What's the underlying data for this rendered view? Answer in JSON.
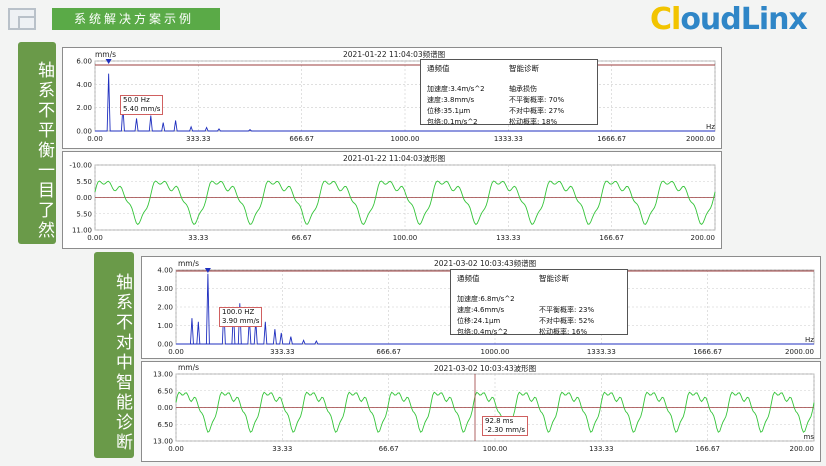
{
  "banner": {
    "title": "系统解决方案示例"
  },
  "logo": {
    "text_a": "Cl",
    "text_b": "oudLinx",
    "full": "CloudLinx"
  },
  "labels": {
    "left1": "轴系不平衡一目了然",
    "left2": "轴系不对中智能诊断"
  },
  "colors": {
    "banner": "#5aaa47",
    "side": "#6a9a49",
    "spectrum": "#1f2fbf",
    "wave": "#35c43a",
    "limit": "#9b3c3c"
  },
  "panels": [
    {
      "id": "p1",
      "title": "2021-01-22  11:04:03频谱图",
      "unit": "mm/s",
      "yticks": [
        "6.00",
        "4.00",
        "2.00",
        "0.00"
      ],
      "xticks": [
        "0.00",
        "333.33",
        "666.67",
        "1000.00",
        "1333.33",
        "1666.67",
        "2000.00"
      ],
      "xunit": "Hz",
      "peak_label_1": "50.0 Hz",
      "peak_label_2": "5.40 mm/s",
      "info": {
        "h1": "通频值",
        "h2": "智能诊断",
        "l1": "加速度:3.4m/s^2",
        "l2": "速度:3.8mm/s",
        "l3": "位移:35.1μm",
        "l4": "包络:0.1m/s^2",
        "r1": "轴承损伤",
        "r2": "不平衡概率: 70%",
        "r3": "不对中概率: 27%",
        "r4": "松动概率: 18%"
      }
    },
    {
      "id": "p2",
      "title": "2021-01-22  11:04:03波形图",
      "unit": "",
      "yticks": [
        "-10.00",
        "5.50",
        "0.00",
        "5.50",
        "11.00"
      ],
      "xticks": [
        "0.00",
        "33.33",
        "66.67",
        "100.00",
        "133.33",
        "166.67",
        "200.00"
      ],
      "xunit": ""
    },
    {
      "id": "p3",
      "title": "2021-03-02  10:03:43频谱图",
      "unit": "mm/s",
      "yticks": [
        "4.00",
        "3.00",
        "2.00",
        "1.00",
        "0.00"
      ],
      "xticks": [
        "0.00",
        "333.33",
        "666.67",
        "1000.00",
        "1333.33",
        "1666.67",
        "2000.00"
      ],
      "xunit": "Hz",
      "peak_label_1": "100.0 HZ",
      "peak_label_2": "3.90 mm/s",
      "info": {
        "h1": "通频值",
        "h2": "智能诊断",
        "l1": "加速度:6.8m/s^2",
        "l2": "速度:4.6mm/s",
        "l3": "位移:24.1μm",
        "l4": "包络:0.4m/s^2",
        "r1": "",
        "r2": "不平衡概率: 23%",
        "r3": "不对中概率: 52%",
        "r4": "松动概率: 16%"
      }
    },
    {
      "id": "p4",
      "title": "2021-03-02  10:03:43波形图",
      "unit": "mm/s",
      "yticks": [
        "13.00",
        "6.50",
        "0.00",
        "6.50",
        "13.00"
      ],
      "xticks": [
        "0.00",
        "33.33",
        "66.67",
        "100.00",
        "133.33",
        "166.67",
        "200.00"
      ],
      "xunit": "ms",
      "cursor_label_1": "92.8 ms",
      "cursor_label_2": "-2.30 mm/s"
    }
  ]
}
